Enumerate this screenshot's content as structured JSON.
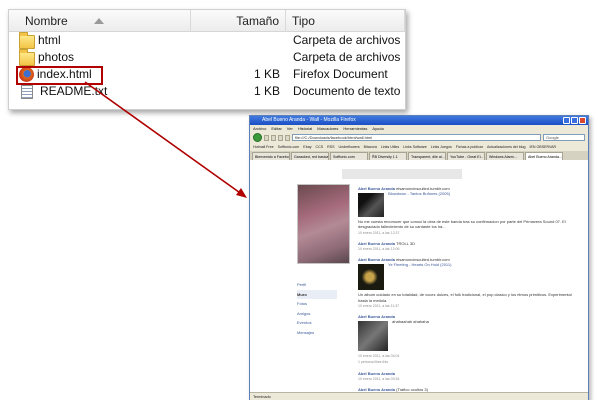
{
  "explorer": {
    "columns": {
      "name": "Nombre",
      "size": "Tamaño",
      "type": "Tipo"
    },
    "files": [
      {
        "name": "html",
        "size": "",
        "type": "Carpeta de archivos",
        "icon": "folder-icon"
      },
      {
        "name": "photos",
        "size": "",
        "type": "Carpeta de archivos",
        "icon": "folder-icon"
      },
      {
        "name": "index.html",
        "size": "1 KB",
        "type": "Firefox Document",
        "icon": "firefox-icon",
        "selected": true
      },
      {
        "name": "README.txt",
        "size": "1 KB",
        "type": "Documento de texto",
        "icon": "text-file-icon"
      }
    ],
    "highlight_color": "#b00000"
  },
  "browser": {
    "title": "Abel Bueno Aranda - Wall - Mozilla Firefox",
    "menu": [
      "Archivo",
      "Editar",
      "Ver",
      "Historial",
      "Marcadores",
      "Herramientas",
      "Ayuda"
    ],
    "url": "file:///C:/Downloads/facebook/html/wall.html",
    "search": "Google",
    "bookmarks": [
      "Hotmail Free",
      "Sofftonic.com",
      "Ebay",
      "CCS",
      "RSS",
      "Underflowers",
      "Bitacora",
      "Links Utiles",
      "Links Software",
      "Links Juegos",
      "Fichas a publicar",
      "Actualizaciones del blog",
      "IEN OBSERVAR"
    ],
    "tabs": [
      "Bienvenido a Facebook",
      "Garaoked, red basica",
      "Sofftonic.com",
      "ŘB Diversity 1.1",
      "Transparent, dile al...",
      "YouTube - Great Ei...",
      "Windows Alarm...",
      "Abel Bueno Aranda..."
    ],
    "status": "Terminado",
    "profile_nav": [
      "Perfil",
      "Muro",
      "Fotos",
      "Amigos",
      "Eventos",
      "Mensajes"
    ],
    "feed": [
      {
        "author": "Abel Bueno Aranda",
        "text": "elsamoncinsculted.tumblr.com",
        "link": "Blowdown - Tantos Bufones (2005)",
        "body": "No me cuesta reconocer que conoci la obra de este banda tras su confirmacion por parte del Primavera Sound 07. El desgraciado fallecimiento de su cantante los ha...",
        "meta": "10 enero 2011, a las 12:37",
        "thumb": "t1"
      },
      {
        "author": "Abel Bueno Aranda",
        "text": "TROLL 3D",
        "meta": "10 enero 2011, a las 12:06"
      },
      {
        "author": "Abel Bueno Aranda",
        "text": "elsamoncinsculted.tumblr.com",
        "link": "Ye Fleeting - Hearts On Hold (2011)",
        "body": "Un album cuidado en su totalidad, de vocez dulces, el folk tradicional, el pop clasico y los ritmos primitivos. Experimental hasta la medula.",
        "meta": "10 enero 2011, a las 11:37",
        "thumb": "t2"
      },
      {
        "author": "Abel Bueno Aranda",
        "text": "ahahaahah ahahaha",
        "meta": "10 enero 2011, a las 04:04",
        "extra": "1 persona likes this.",
        "thumb": "t3"
      },
      {
        "author": "Abel Bueno Aranda",
        "text": "",
        "meta": "10 enero 2011, a las 03:34"
      },
      {
        "author": "Abel Bueno Aranda",
        "text": "(Trafico ocultos 3)",
        "meta": ""
      }
    ]
  }
}
